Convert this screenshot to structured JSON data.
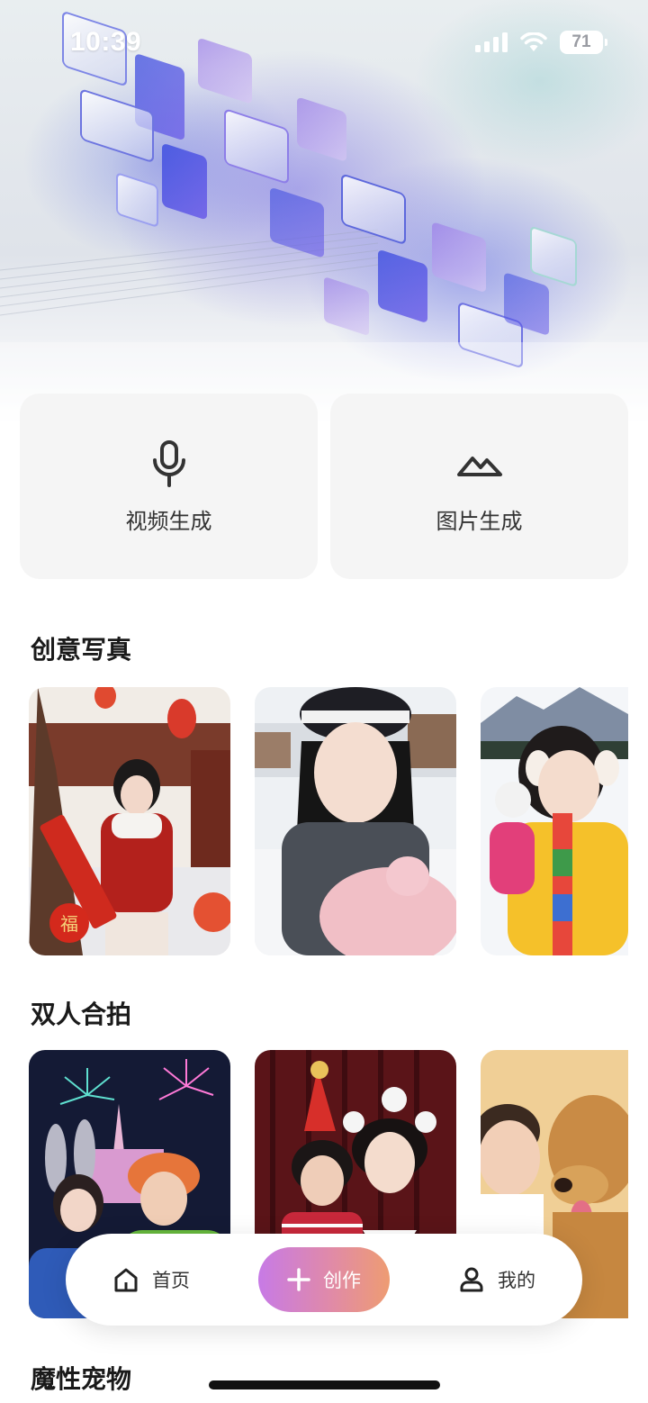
{
  "status_bar": {
    "time": "10:39",
    "battery": "71"
  },
  "actions": [
    {
      "label": "视频生成",
      "icon": "microphone-icon"
    },
    {
      "label": "图片生成",
      "icon": "mountain-icon"
    }
  ],
  "sections": [
    {
      "title": "创意写真"
    },
    {
      "title": "双人合拍"
    },
    {
      "title": "魔性宠物"
    }
  ],
  "nav": {
    "home_label": "首页",
    "create_label": "创作",
    "profile_label": "我的"
  },
  "colors": {
    "card_bg": "#f5f5f5",
    "create_gradient": [
      "#c77ae6",
      "#e08aa8",
      "#ee9c72"
    ]
  }
}
